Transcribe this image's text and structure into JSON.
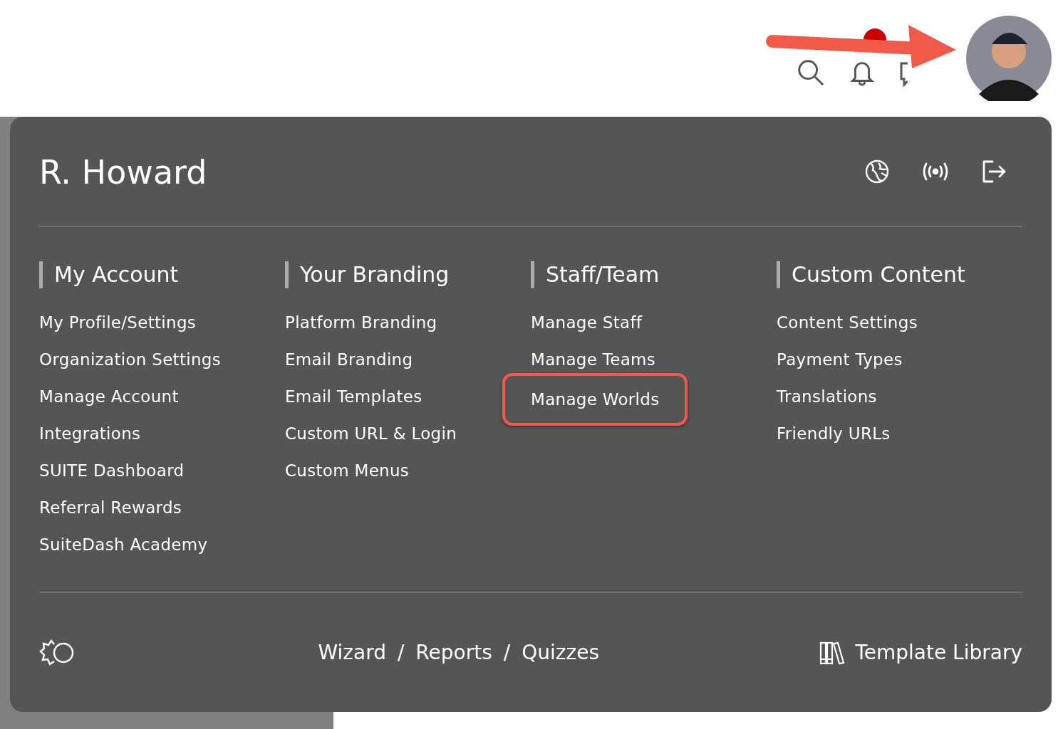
{
  "user": {
    "name": "R. Howard"
  },
  "columns": [
    {
      "heading": "My Account",
      "items": [
        {
          "label": "My Profile/Settings",
          "highlighted": false
        },
        {
          "label": "Organization Settings",
          "highlighted": false
        },
        {
          "label": "Manage Account",
          "highlighted": false
        },
        {
          "label": "Integrations",
          "highlighted": false
        },
        {
          "label": "SUITE Dashboard",
          "highlighted": false
        },
        {
          "label": "Referral Rewards",
          "highlighted": false
        },
        {
          "label": "SuiteDash Academy",
          "highlighted": false
        }
      ]
    },
    {
      "heading": "Your Branding",
      "items": [
        {
          "label": "Platform Branding",
          "highlighted": false
        },
        {
          "label": "Email Branding",
          "highlighted": false
        },
        {
          "label": "Email Templates",
          "highlighted": false
        },
        {
          "label": "Custom URL & Login",
          "highlighted": false
        },
        {
          "label": "Custom Menus",
          "highlighted": false
        }
      ]
    },
    {
      "heading": "Staff/Team",
      "items": [
        {
          "label": "Manage Staff",
          "highlighted": false
        },
        {
          "label": "Manage Teams",
          "highlighted": false
        },
        {
          "label": "Manage Worlds",
          "highlighted": true
        }
      ]
    },
    {
      "heading": "Custom Content",
      "items": [
        {
          "label": "Content Settings",
          "highlighted": false
        },
        {
          "label": "Payment Types",
          "highlighted": false
        },
        {
          "label": "Translations",
          "highlighted": false
        },
        {
          "label": "Friendly URLs",
          "highlighted": false
        }
      ]
    }
  ],
  "footer": {
    "links": [
      "Wizard",
      "Reports",
      "Quizzes"
    ],
    "separator": "/",
    "library": "Template Library"
  }
}
